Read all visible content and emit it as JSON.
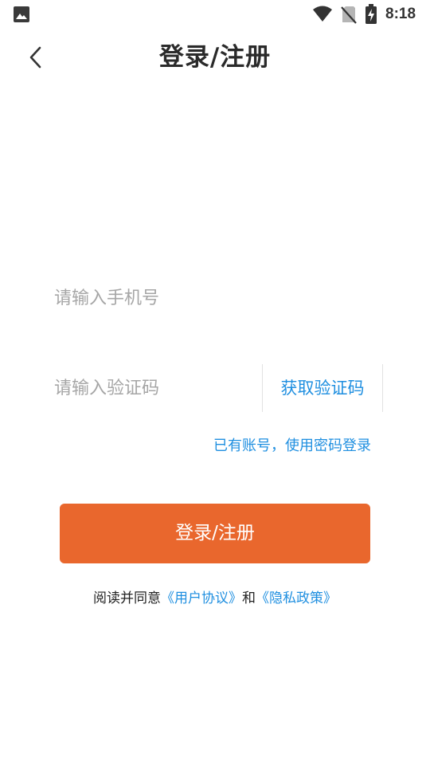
{
  "status_bar": {
    "time": "8:18",
    "icons": [
      "gallery-icon",
      "wifi-icon",
      "no-sim-icon",
      "battery-charging-icon"
    ],
    "icon_color": "#333333"
  },
  "header": {
    "back_icon": "chevron-left-icon",
    "title": "登录/注册"
  },
  "form": {
    "phone_placeholder": "请输入手机号",
    "phone_value": "",
    "code_placeholder": "请输入验证码",
    "code_value": "",
    "get_code_label": "获取验证码",
    "password_login_label": "已有账号，使用密码登录",
    "login_label": "登录/注册"
  },
  "agreement": {
    "prefix": "阅读并同意",
    "user_agreement": "《用户协议》",
    "conjunction": "和",
    "privacy_policy": "《隐私政策》"
  },
  "colors": {
    "accent": "#e9672d",
    "link": "#1f8fe0",
    "placeholder": "#a6a6a6",
    "divider": "#e2e2e2"
  }
}
